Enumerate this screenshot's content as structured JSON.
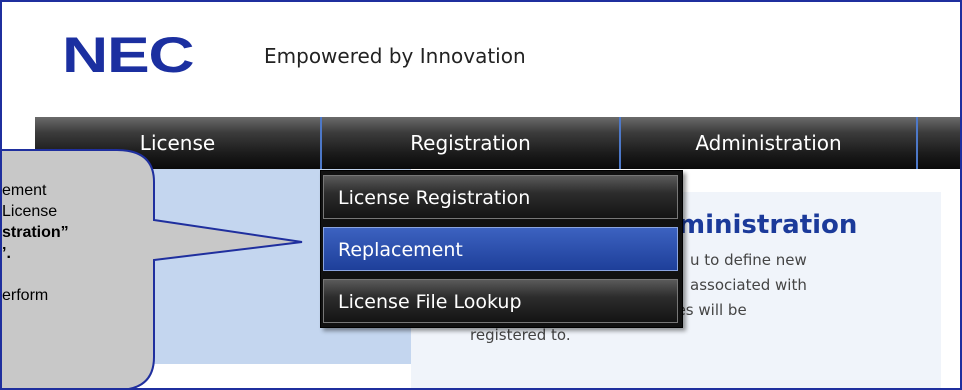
{
  "header": {
    "logo_text": "NEC",
    "tagline": "Empowered by Innovation"
  },
  "nav": {
    "items": [
      {
        "label": "License"
      },
      {
        "label": "Registration"
      },
      {
        "label": "Administration"
      }
    ]
  },
  "dropdown": {
    "items": [
      {
        "label": "License Registration"
      },
      {
        "label": "Replacement"
      },
      {
        "label": "License File Lookup"
      }
    ],
    "selected": "Replacement"
  },
  "main": {
    "heading_fragment": "ministration",
    "body_lines": [
      "u to define new",
      "associated with",
      "customers where the licenses will be",
      "registered to."
    ]
  },
  "callout": {
    "lines": [
      "ement",
      "License",
      "stration”",
      "’.",
      "",
      "erform"
    ]
  },
  "colors": {
    "frame_border": "#1f2f9e",
    "logo": "#1b2fa0",
    "nav_separator": "#4d78c8",
    "selected_item": "#2a4fae"
  }
}
